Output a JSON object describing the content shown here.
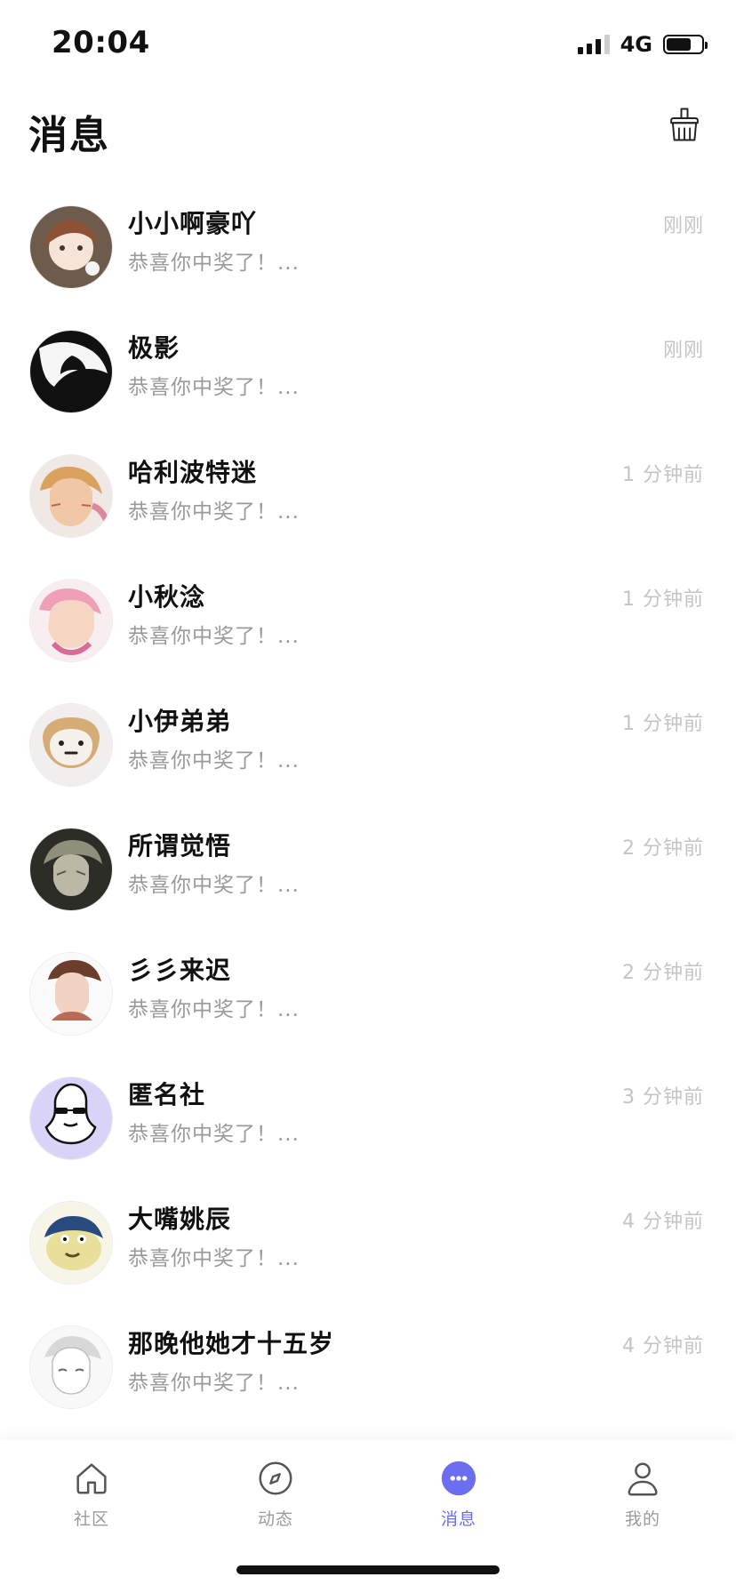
{
  "status_bar": {
    "time": "20:04",
    "network": "4G",
    "battery_level": 0.7
  },
  "header": {
    "title": "消息",
    "clear_icon": "broom-icon"
  },
  "messages": [
    {
      "name": "小小啊豪吖",
      "preview": "恭喜你中奖了！...",
      "time": "刚刚",
      "avatar_color": "#7b5b45"
    },
    {
      "name": "极影",
      "preview": "恭喜你中奖了！...",
      "time": "刚刚",
      "avatar_color": "#222222"
    },
    {
      "name": "哈利波特迷",
      "preview": "恭喜你中奖了！...",
      "time": "1 分钟前",
      "avatar_color": "#e7b46b"
    },
    {
      "name": "小秋淰",
      "preview": "恭喜你中奖了！...",
      "time": "1 分钟前",
      "avatar_color": "#f2a7b8"
    },
    {
      "name": "小伊弟弟",
      "preview": "恭喜你中奖了！...",
      "time": "1 分钟前",
      "avatar_color": "#d9b27a"
    },
    {
      "name": "所谓觉悟",
      "preview": "恭喜你中奖了！...",
      "time": "2 分钟前",
      "avatar_color": "#4a4a3f"
    },
    {
      "name": "彡彡来迟",
      "preview": "恭喜你中奖了！...",
      "time": "2 分钟前",
      "avatar_color": "#8c5a45"
    },
    {
      "name": "匿名社",
      "preview": "恭喜你中奖了！...",
      "time": "3 分钟前",
      "avatar_color": "#d9d2f7"
    },
    {
      "name": "大嘴姚辰",
      "preview": "恭喜你中奖了！...",
      "time": "4 分钟前",
      "avatar_color": "#e6df9a"
    },
    {
      "name": "那晚他她才十五岁",
      "preview": "恭喜你中奖了！...",
      "time": "4 分钟前",
      "avatar_color": "#dddddd"
    },
    {
      "name": "",
      "preview": "",
      "time": "",
      "avatar_color": "#8b6a55"
    }
  ],
  "tabs": [
    {
      "label": "社区",
      "icon": "home-icon"
    },
    {
      "label": "动态",
      "icon": "compass-icon"
    },
    {
      "label": "消息",
      "icon": "message-icon"
    },
    {
      "label": "我的",
      "icon": "profile-icon"
    }
  ],
  "colors": {
    "accent": "#6b6ef0",
    "secondary_text": "#9a9a9a",
    "time_text": "#c4c4c4"
  }
}
